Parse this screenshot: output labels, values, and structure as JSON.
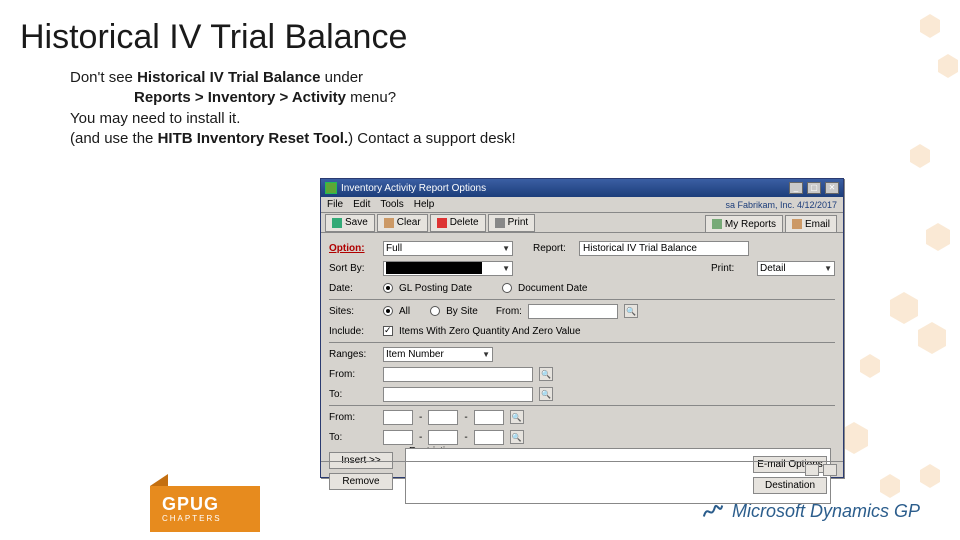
{
  "title": "Historical IV Trial Balance",
  "body": {
    "l1a": "Don't see ",
    "l1b": "Historical IV Trial Balance",
    "l1c": " under",
    "l2a": "Reports > Inventory > Activity",
    "l2b": " menu?",
    "l3": "You may need to install it.",
    "l4a": "(and use the ",
    "l4b": "HITB Inventory Reset Tool.",
    "l4c": ") Contact a support desk!"
  },
  "gpug": {
    "name": "GPUG",
    "sub": "CHAPTERS"
  },
  "msgp": "Microsoft Dynamics GP",
  "win": {
    "title": "Inventory Activity Report Options",
    "menus": {
      "file": "File",
      "edit": "Edit",
      "tools": "Tools",
      "help": "Help"
    },
    "useron": "sa Fabrikam, Inc. 4/12/2017",
    "toolbar": {
      "save": "Save",
      "clear": "Clear",
      "delete": "Delete",
      "print": "Print",
      "myreports": "My Reports",
      "email": "Email"
    },
    "labels": {
      "option": "Option:",
      "report": "Report:",
      "sortby": "Sort By:",
      "print_lbl": "Print:",
      "date": "Date:",
      "sites": "Sites:",
      "include": "Include:",
      "ranges": "Ranges:",
      "from": "From:",
      "to": "To:",
      "insert": "Insert >>",
      "remove": "Remove",
      "restrictions": "Restrictions:",
      "emailopt": "E-mail Options",
      "destination": "Destination",
      "glposting": "GL Posting Date",
      "docdate": "Document Date",
      "site_all": "All",
      "site_by": "By Site",
      "checkbox": "Items With Zero Quantity And Zero Value"
    },
    "values": {
      "option": "Full",
      "report": "Historical IV Trial Balance",
      "print": "Detail",
      "ranges": "Item Number"
    }
  }
}
